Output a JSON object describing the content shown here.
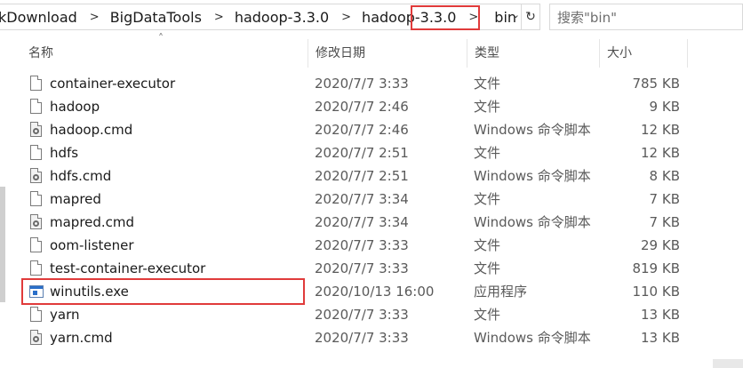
{
  "breadcrumb": {
    "items": [
      "kDownload",
      "BigDataTools",
      "hadoop-3.3.0",
      "hadoop-3.3.0",
      "bin"
    ],
    "separator": ">"
  },
  "search": {
    "placeholder": "搜索\"bin\""
  },
  "columns": {
    "name": "名称",
    "date": "修改日期",
    "type": "类型",
    "size": "大小"
  },
  "highlight_color": "#e03b3b",
  "files": [
    {
      "name": "container-executor",
      "date": "2020/7/7 3:33",
      "type": "文件",
      "size": "785 KB",
      "icon": "file-icon"
    },
    {
      "name": "hadoop",
      "date": "2020/7/7 2:46",
      "type": "文件",
      "size": "9 KB",
      "icon": "file-icon"
    },
    {
      "name": "hadoop.cmd",
      "date": "2020/7/7 2:46",
      "type": "Windows 命令脚本",
      "size": "12 KB",
      "icon": "cmd-file-icon"
    },
    {
      "name": "hdfs",
      "date": "2020/7/7 2:51",
      "type": "文件",
      "size": "12 KB",
      "icon": "file-icon"
    },
    {
      "name": "hdfs.cmd",
      "date": "2020/7/7 2:51",
      "type": "Windows 命令脚本",
      "size": "8 KB",
      "icon": "cmd-file-icon"
    },
    {
      "name": "mapred",
      "date": "2020/7/7 3:34",
      "type": "文件",
      "size": "7 KB",
      "icon": "file-icon"
    },
    {
      "name": "mapred.cmd",
      "date": "2020/7/7 3:34",
      "type": "Windows 命令脚本",
      "size": "7 KB",
      "icon": "cmd-file-icon"
    },
    {
      "name": "oom-listener",
      "date": "2020/7/7 3:33",
      "type": "文件",
      "size": "29 KB",
      "icon": "file-icon"
    },
    {
      "name": "test-container-executor",
      "date": "2020/7/7 3:33",
      "type": "文件",
      "size": "819 KB",
      "icon": "file-icon"
    },
    {
      "name": "winutils.exe",
      "date": "2020/10/13 16:00",
      "type": "应用程序",
      "size": "110 KB",
      "icon": "exe-file-icon"
    },
    {
      "name": "yarn",
      "date": "2020/7/7 3:33",
      "type": "文件",
      "size": "13 KB",
      "icon": "file-icon"
    },
    {
      "name": "yarn.cmd",
      "date": "2020/7/7 3:33",
      "type": "Windows 命令脚本",
      "size": "13 KB",
      "icon": "cmd-file-icon"
    }
  ]
}
